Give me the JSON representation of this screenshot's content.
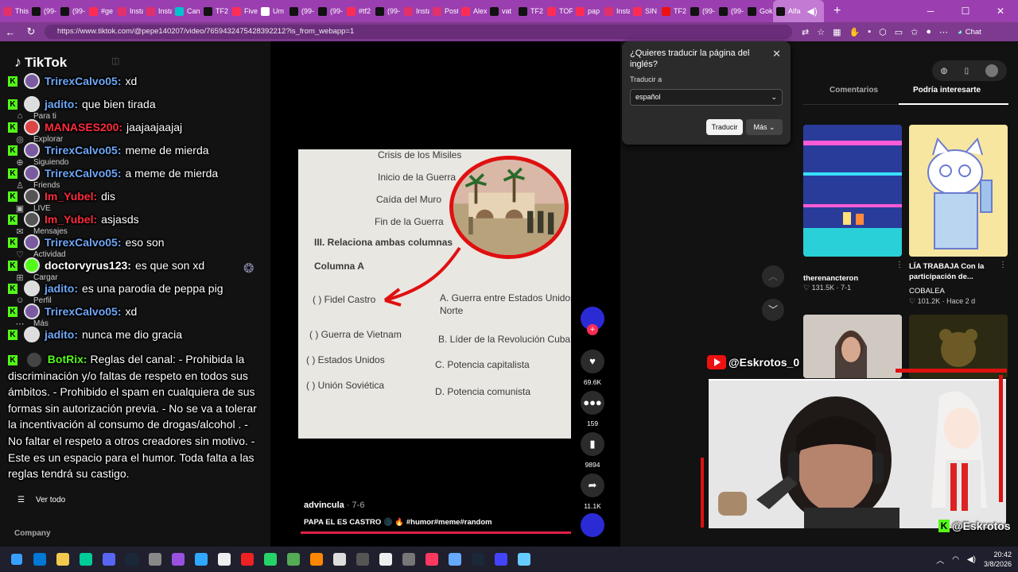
{
  "browser": {
    "tabs": [
      {
        "label": "This",
        "color": "#e1306c"
      },
      {
        "label": "(99-",
        "color": "#111"
      },
      {
        "label": "(99-",
        "color": "#111"
      },
      {
        "label": "#ge",
        "color": "#fe2c55"
      },
      {
        "label": "Insta",
        "color": "#e1306c"
      },
      {
        "label": "Insta",
        "color": "#e1306c"
      },
      {
        "label": "Can",
        "color": "#00c4cc"
      },
      {
        "label": "TF2",
        "color": "#111"
      },
      {
        "label": "Five",
        "color": "#ff2d55"
      },
      {
        "label": "Um",
        "color": "#fff"
      },
      {
        "label": "(99-",
        "color": "#111"
      },
      {
        "label": "(99-",
        "color": "#111"
      },
      {
        "label": "#tf2",
        "color": "#fe2c55"
      },
      {
        "label": "(99-",
        "color": "#111"
      },
      {
        "label": "Insta",
        "color": "#e1306c"
      },
      {
        "label": "Post",
        "color": "#e1306c"
      },
      {
        "label": "Alex",
        "color": "#fe2c55"
      },
      {
        "label": "vat",
        "color": "#111"
      },
      {
        "label": "TF2",
        "color": "#111"
      },
      {
        "label": "TOP",
        "color": "#ff2d55"
      },
      {
        "label": "pap",
        "color": "#fe2c55"
      },
      {
        "label": "Insta",
        "color": "#e1306c"
      },
      {
        "label": "SIN",
        "color": "#fe2c55"
      },
      {
        "label": "TF2",
        "color": "#e11"
      },
      {
        "label": "(99-",
        "color": "#111"
      },
      {
        "label": "(99-",
        "color": "#111"
      },
      {
        "label": "Gok",
        "color": "#111"
      },
      {
        "label": "Alfa",
        "color": "#111"
      }
    ],
    "url": "https://www.tiktok.com/@pepe140207/video/7659432475428392212?is_from_webapp=1",
    "chat_label": "Chat",
    "new_tab": "+",
    "back": "←",
    "reload": "↻"
  },
  "tiktok": {
    "logo_text": "TikTok",
    "nav": [
      {
        "label": "Para ti",
        "icon": "⌂"
      },
      {
        "label": "Explorar",
        "icon": "◎"
      },
      {
        "label": "Siguiendo",
        "icon": "⊕"
      },
      {
        "label": "Friends",
        "icon": "♙"
      },
      {
        "label": "LIVE",
        "icon": "▣"
      },
      {
        "label": "Mensajes",
        "icon": "✉"
      },
      {
        "label": "Actividad",
        "icon": "♡"
      },
      {
        "label": "Cargar",
        "icon": "⊞"
      },
      {
        "label": "Perfil",
        "icon": "☺"
      },
      {
        "label": "Más",
        "icon": "⋯"
      }
    ],
    "ver_todo": "Ver todo",
    "company": "Company"
  },
  "chat": {
    "messages": [
      {
        "user": "TrirexCalvo05:",
        "text": "xd",
        "color": "#6fa8f7",
        "av": "#7a5aa0"
      },
      {
        "user": "jadito:",
        "text": "que bien tirada",
        "color": "#6fa8f7",
        "av": "#ddd"
      },
      {
        "user": "MANASES200:",
        "text": "jaajaajaajaj",
        "color": "#ff2b3d",
        "av": "#d44"
      },
      {
        "user": "TrirexCalvo05:",
        "text": "meme de mierda",
        "color": "#6fa8f7",
        "av": "#7a5aa0"
      },
      {
        "user": "TrirexCalvo05:",
        "text": "a meme de mierda",
        "color": "#6fa8f7",
        "av": "#7a5aa0"
      },
      {
        "user": "Im_Yubel:",
        "text": "dis",
        "color": "#ff2b3d",
        "av": "#555"
      },
      {
        "user": "Im_Yubel:",
        "text": "asjasds",
        "color": "#ff2b3d",
        "av": "#555"
      },
      {
        "user": "TrirexCalvo05:",
        "text": "eso son",
        "color": "#6fa8f7",
        "av": "#7a5aa0"
      },
      {
        "user": "doctorvyrus123:",
        "text": "es que son xd",
        "color": "#ffffff",
        "av": "#53fc18"
      },
      {
        "user": "jadito:",
        "text": "es una parodia de peppa pig",
        "color": "#6fa8f7",
        "av": "#ddd"
      },
      {
        "user": "TrirexCalvo05:",
        "text": "xd",
        "color": "#6fa8f7",
        "av": "#7a5aa0"
      },
      {
        "user": "jadito:",
        "text": "nunca me dio gracia",
        "color": "#6fa8f7",
        "av": "#ddd"
      }
    ],
    "bot_name": "BotRix:",
    "bot_text": "Reglas del canal: - Prohibida la discriminación y/o faltas de respeto en todos sus ámbitos. - Prohibido el spam en cualquiera de sus formas sin autorización previa. - No se va a tolerar la incentivación al consumo de drogas/alcohol . - No faltar el respeto a otros creadores sin motivo. - Este es un espacio para el humor. Toda falta a las reglas tendrá su castigo.",
    "kick_letter": "K"
  },
  "video": {
    "worksheet": [
      "Crisis de los Misiles",
      "Inicio de la Guerra",
      "Caída del Muro",
      "Fin de la Guerra",
      "III. Relaciona ambas columnas",
      "Columna A",
      "( ) Fidel Castro",
      "( ) Guerra de Vietnam",
      "( ) Estados Unidos",
      "( ) Unión Soviética",
      "A. Guerra entre Estados Unidos y",
      "Norte",
      "B. Líder de la Revolución Cubana",
      "C. Potencia capitalista",
      "D. Potencia comunista"
    ],
    "author": "advincula",
    "date": "· 7-6",
    "caption": "PAPA EL ES CASTRO 🌑 🔥 #humor#meme#random",
    "likes": "69.6K",
    "comments": "159",
    "saves": "9894",
    "shares": "11.1K"
  },
  "translate": {
    "question": "¿Quieres traducir la página del inglés?",
    "label": "Traducir a",
    "language": "español",
    "translate_btn": "Traducir",
    "more_btn": "Más"
  },
  "right_panel": {
    "tab_comments": "Comentarios",
    "tab_interest": "Podría interesarte",
    "videos": [
      {
        "title": "",
        "author": "therenancteron",
        "meta": "♡ 131.5K · 7-1"
      },
      {
        "title": "LÍA TRABAJA Con la participación de...",
        "author": "COBALEA",
        "meta": "♡ 101.2K · Hace 2 d"
      }
    ]
  },
  "stream": {
    "handle_top": "@Eskrotos_0",
    "handle_bottom": "@Eskrotos"
  },
  "taskbar": {
    "time": "20:42",
    "date": "3/8/2026",
    "icons": [
      "#0078d4",
      "#f2c94c",
      "#0c9",
      "#5865f2",
      "#1b2838",
      "#888",
      "#9b51e0",
      "#31a8ff",
      "#eee",
      "#e22",
      "#25d366",
      "#5a5",
      "#f80",
      "#ddd",
      "#555",
      "#eee",
      "#777",
      "#ff3860",
      "#6af",
      "#1b2838",
      "#44f",
      "#6cf"
    ]
  }
}
